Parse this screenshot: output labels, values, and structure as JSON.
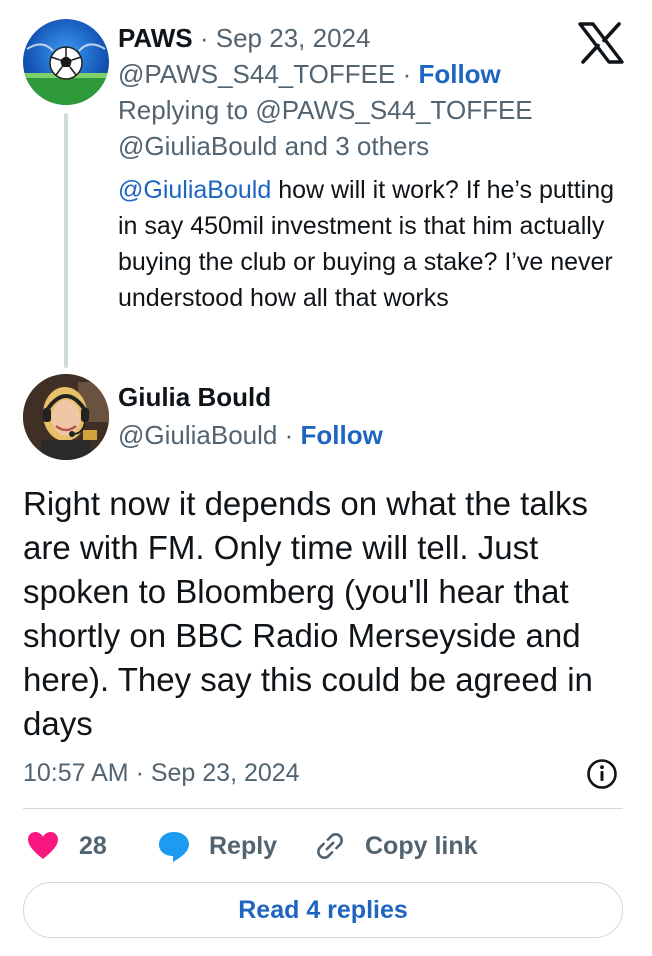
{
  "parent_tweet": {
    "author_name": "PAWS",
    "separator": " · ",
    "date": "Sep 23, 2024",
    "handle": "@PAWS_S44_TOFFEE",
    "follow_label": "Follow",
    "replying_prefix": "Replying to ",
    "replying_handle": "@PAWS_S44_TOFFEE",
    "replying_line2_mention": "@GiuliaBould",
    "replying_line2_rest": " and 3 others",
    "body_mention": "@GiuliaBould",
    "body_text": " how will it work? If he’s putting in say 450mil investment is that him actually buying the club or buying a stake? I’ve never understood how all that works",
    "avatar_icon": "soccer-ball-avatar"
  },
  "main_tweet": {
    "author_name": "Giulia Bould",
    "handle": "@GiuliaBould",
    "separator": " · ",
    "follow_label": "Follow",
    "body_text": "Right now it depends on what the talks are with FM. Only time will tell. Just spoken to Bloomberg (you'll hear that shortly on BBC Radio Merseyside and here). They say this could be agreed in days",
    "timestamp": "10:57 AM · Sep 23, 2024",
    "avatar_icon": "person-with-headset-avatar"
  },
  "actions": {
    "like_count": "28",
    "reply_label": "Reply",
    "copy_link_label": "Copy link",
    "read_replies_label": "Read 4 replies"
  },
  "colors": {
    "link_blue": "#1d65c1",
    "heart_pink": "#f91880",
    "reply_bubble_blue": "#1d9bf0",
    "secondary_text": "#536471",
    "divider": "#cfd9de"
  }
}
